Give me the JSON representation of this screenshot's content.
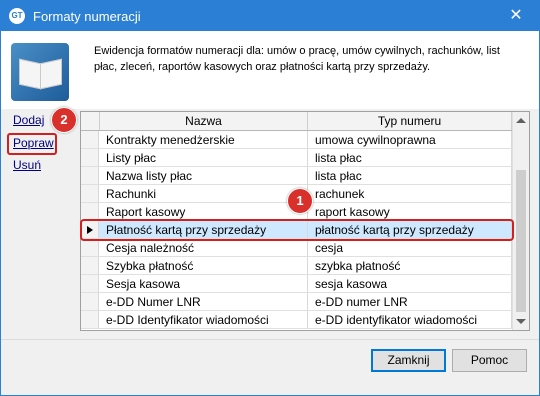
{
  "window": {
    "title": "Formaty numeracji"
  },
  "header": {
    "description": "Ewidencja formatów numeracji dla: umów o pracę, umów cywilnych, rachunków, list płac, zleceń, raportów kasowych oraz płatności kartą przy sprzedaży."
  },
  "actions": {
    "add": "Dodaj",
    "edit": "Popraw",
    "delete": "Usuń"
  },
  "annotations": {
    "badge_1": "1",
    "badge_2": "2"
  },
  "grid": {
    "columns": [
      "Nazwa",
      "Typ numeru"
    ],
    "rows": [
      {
        "name": "Kontrakty menedżerskie",
        "type": "umowa cywilnoprawna"
      },
      {
        "name": "Listy płac",
        "type": "lista płac"
      },
      {
        "name": "Nazwa listy płac",
        "type": "lista płac"
      },
      {
        "name": "Rachunki",
        "type": "rachunek"
      },
      {
        "name": "Raport kasowy",
        "type": "raport kasowy"
      },
      {
        "name": "Płatność kartą przy sprzedaży",
        "type": "płatność kartą przy sprzedaży",
        "selected": true
      },
      {
        "name": "Cesja należność",
        "type": "cesja"
      },
      {
        "name": "Szybka płatność",
        "type": "szybka płatność"
      },
      {
        "name": "Sesja kasowa",
        "type": "sesja kasowa"
      },
      {
        "name": "e-DD Numer LNR",
        "type": "e-DD numer LNR"
      },
      {
        "name": "e-DD Identyfikator wiadomości",
        "type": "e-DD identyfikator wiadomości"
      }
    ]
  },
  "footer": {
    "close": "Zamknij",
    "help": "Pomoc"
  },
  "colors": {
    "titlebar": "#2b7fd4",
    "selection": "#cde8ff",
    "highlight": "#d21f1f",
    "badge": "#d9302b"
  },
  "icons": [
    "app-icon",
    "close-icon",
    "book-icon",
    "row-indicator-icon",
    "scroll-up-icon",
    "scroll-down-icon"
  ]
}
